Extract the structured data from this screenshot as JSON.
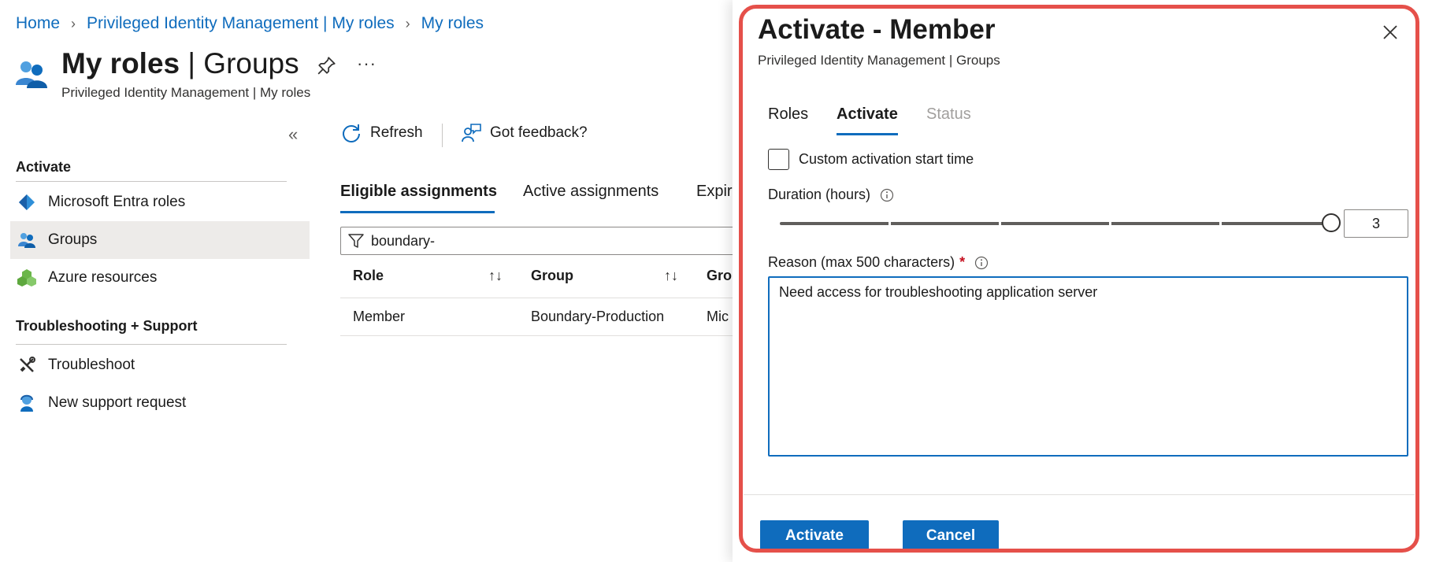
{
  "breadcrumb": [
    {
      "label": "Home"
    },
    {
      "label": "Privileged Identity Management | My roles"
    },
    {
      "label": "My roles"
    }
  ],
  "page": {
    "title_main": "My roles",
    "title_sep": " | ",
    "title_section": "Groups",
    "subtitle": "Privileged Identity Management | My roles",
    "more": "···",
    "collapse": "«"
  },
  "sidebar": {
    "sections": [
      {
        "heading": "Activate",
        "items": [
          {
            "label": "Microsoft Entra roles",
            "icon": "entra-diamond-icon"
          },
          {
            "label": "Groups",
            "icon": "groups-icon",
            "selected": true
          },
          {
            "label": "Azure resources",
            "icon": "azure-resources-icon"
          }
        ]
      },
      {
        "heading": "Troubleshooting + Support",
        "items": [
          {
            "label": "Troubleshoot",
            "icon": "tools-icon"
          },
          {
            "label": "New support request",
            "icon": "support-person-icon"
          }
        ]
      }
    ]
  },
  "toolbar": {
    "refresh_label": "Refresh",
    "feedback_label": "Got feedback?"
  },
  "tabs": [
    "Eligible assignments",
    "Active assignments",
    "Expir"
  ],
  "filter": {
    "value": "boundary-"
  },
  "table": {
    "columns": [
      "Role",
      "Group",
      "Gro"
    ],
    "rows": [
      [
        "Member",
        "Boundary-Production",
        "Mic"
      ]
    ]
  },
  "blade": {
    "title": "Activate - Member",
    "subtitle": "Privileged Identity Management | Groups",
    "tabs": [
      "Roles",
      "Activate",
      "Status"
    ],
    "checkbox_label": "Custom activation start time",
    "checkbox_checked": false,
    "duration_label": "Duration (hours)",
    "duration_value": "3",
    "duration_level": 1.0,
    "reason_label": "Reason (max 500 characters)",
    "reason_required": "*",
    "reason_value": "Need access for troubleshooting application server",
    "activate_label": "Activate",
    "cancel_label": "Cancel"
  },
  "colors": {
    "accent": "#0f6cbd",
    "highlight_outline": "#e5504a",
    "selected_bg": "#edebe9"
  }
}
